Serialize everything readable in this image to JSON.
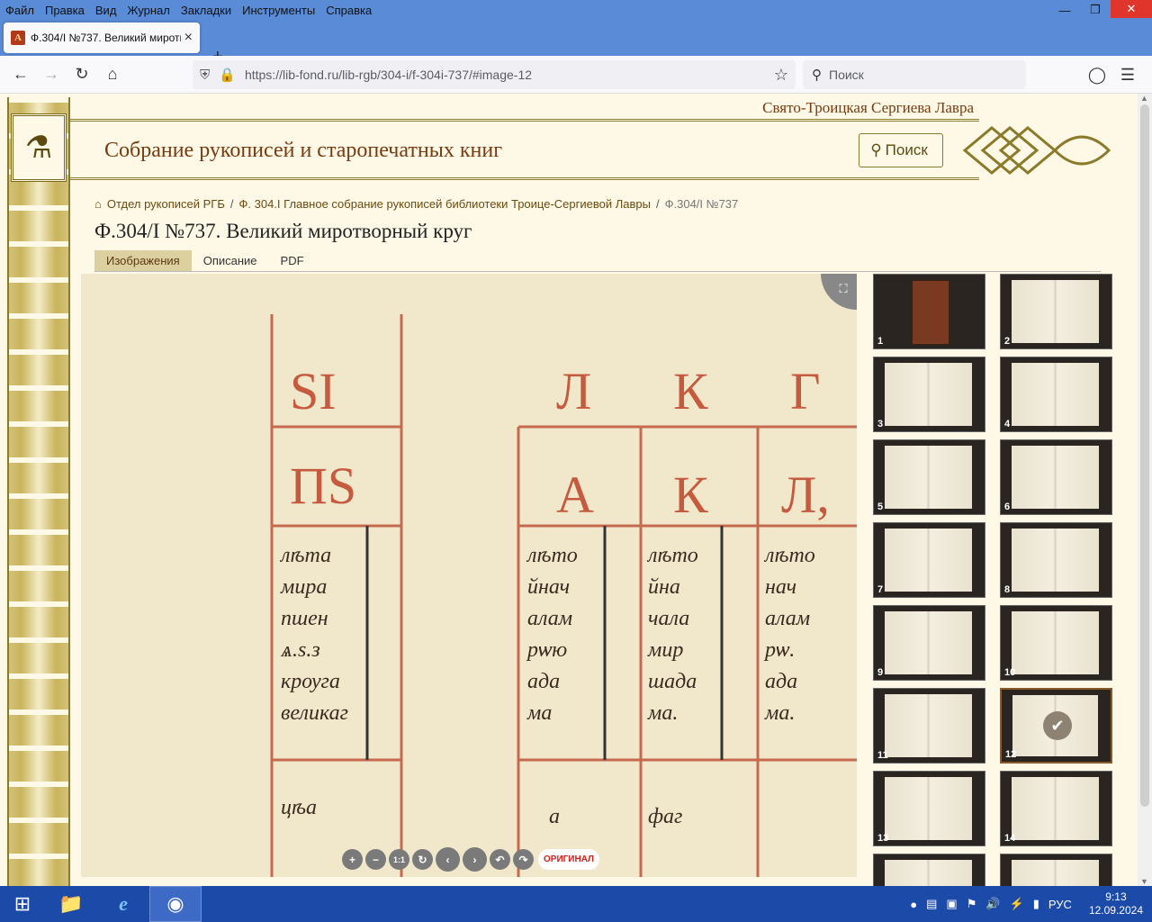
{
  "menu": [
    "Файл",
    "Правка",
    "Вид",
    "Журнал",
    "Закладки",
    "Инструменты",
    "Справка"
  ],
  "browser": {
    "tab_title": "Ф.304/I №737. Великий миротв",
    "url_host": "https://lib-fond.ru",
    "url_path": "/lib-rgb/304-i/f-304i-737/#image-12",
    "search_placeholder": "Поиск"
  },
  "site": {
    "lavra": "Свято-Троицкая Сергиева Лавра",
    "collection_title": "Собрание рукописей и старопечатных книг",
    "search_button": "Поиск"
  },
  "breadcrumb": [
    "Отдел рукописей РГБ",
    "Ф. 304.I Главное собрание рукописей библиотеки Троице-Сергиевой Лавры",
    "Ф.304/I №737"
  ],
  "document": {
    "title": "Ф.304/I №737. Великий миротворный круг",
    "tabs": [
      "Изображения",
      "Описание",
      "PDF"
    ],
    "active_tab": "Изображения"
  },
  "viewer": {
    "original_label": "ОРИГИНАЛ",
    "tools": [
      "zoom-in",
      "zoom-out",
      "one-to-one",
      "reset",
      "prev",
      "next",
      "rotate-left",
      "rotate-right"
    ],
    "tool_glyphs": [
      "+",
      "−",
      "1:1",
      "↻",
      "‹",
      "›",
      "↶",
      "↷"
    ]
  },
  "thumbnails": [
    "1",
    "2",
    "3",
    "4",
    "5",
    "6",
    "7",
    "8",
    "9",
    "10",
    "11",
    "12",
    "13",
    "14"
  ],
  "selected_thumbnail": "12",
  "taskbar": {
    "lang": "РУС",
    "time": "9:13",
    "date": "12.09.2024"
  },
  "colors": {
    "accent_brown": "#7a3a10",
    "tab_active_bg": "#ddd0a0",
    "original_red": "#d0201a",
    "titlebar_blue": "#5a8bd6",
    "taskbar_blue": "#1c4aa8"
  }
}
